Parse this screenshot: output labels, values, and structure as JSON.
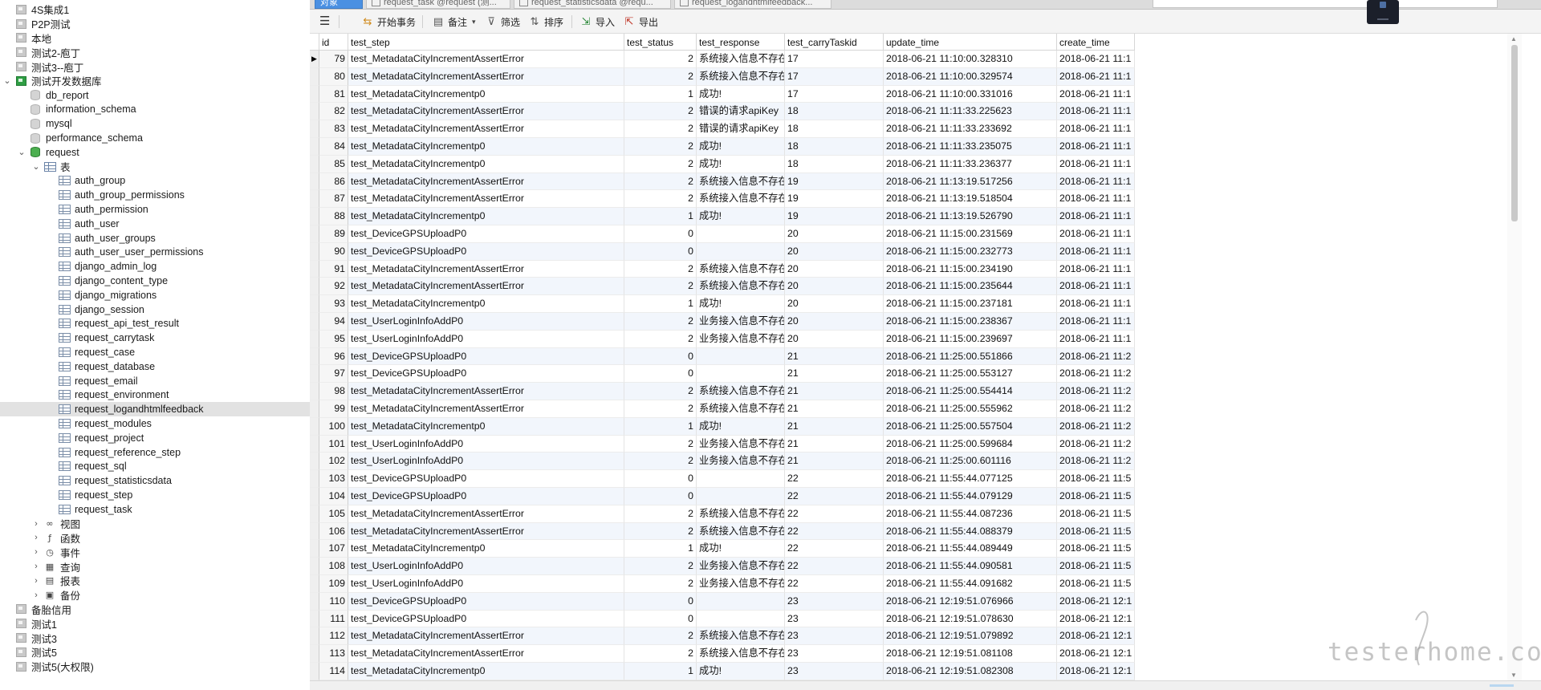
{
  "tabs": [
    {
      "label": "对象",
      "active": true
    },
    {
      "label": "request_task @request (测...",
      "active": false
    },
    {
      "label": "request_statisticsdata @requ...",
      "active": false
    },
    {
      "label": "request_logandhtmlfeedback...",
      "active": false
    }
  ],
  "toolbar": {
    "begin_tx": "开始事务",
    "memo": "备注",
    "filter": "筛选",
    "sort": "排序",
    "import": "导入",
    "export": "导出"
  },
  "tree": [
    {
      "label": "4S集成1",
      "depth": 0,
      "icon": "connection-icon",
      "expander": ""
    },
    {
      "label": "P2P测试",
      "depth": 0,
      "icon": "connection-icon",
      "expander": ""
    },
    {
      "label": "本地",
      "depth": 0,
      "icon": "connection-icon",
      "expander": ""
    },
    {
      "label": "测试2-庖丁",
      "depth": 0,
      "icon": "connection-icon",
      "expander": ""
    },
    {
      "label": "测试3--庖丁",
      "depth": 0,
      "icon": "connection-icon",
      "expander": ""
    },
    {
      "label": "测试开发数据库",
      "depth": 0,
      "icon": "connection-open-icon",
      "expander": "expanded"
    },
    {
      "label": "db_report",
      "depth": 1,
      "icon": "database-icon",
      "expander": ""
    },
    {
      "label": "information_schema",
      "depth": 1,
      "icon": "database-icon",
      "expander": ""
    },
    {
      "label": "mysql",
      "depth": 1,
      "icon": "database-icon",
      "expander": ""
    },
    {
      "label": "performance_schema",
      "depth": 1,
      "icon": "database-icon",
      "expander": ""
    },
    {
      "label": "request",
      "depth": 1,
      "icon": "database-open-icon",
      "expander": "expanded"
    },
    {
      "label": "表",
      "depth": 2,
      "icon": "tables-folder-icon",
      "expander": "expanded"
    },
    {
      "label": "auth_group",
      "depth": 3,
      "icon": "table-icon",
      "expander": ""
    },
    {
      "label": "auth_group_permissions",
      "depth": 3,
      "icon": "table-icon",
      "expander": ""
    },
    {
      "label": "auth_permission",
      "depth": 3,
      "icon": "table-icon",
      "expander": ""
    },
    {
      "label": "auth_user",
      "depth": 3,
      "icon": "table-icon",
      "expander": ""
    },
    {
      "label": "auth_user_groups",
      "depth": 3,
      "icon": "table-icon",
      "expander": ""
    },
    {
      "label": "auth_user_user_permissions",
      "depth": 3,
      "icon": "table-icon",
      "expander": ""
    },
    {
      "label": "django_admin_log",
      "depth": 3,
      "icon": "table-icon",
      "expander": ""
    },
    {
      "label": "django_content_type",
      "depth": 3,
      "icon": "table-icon",
      "expander": ""
    },
    {
      "label": "django_migrations",
      "depth": 3,
      "icon": "table-icon",
      "expander": ""
    },
    {
      "label": "django_session",
      "depth": 3,
      "icon": "table-icon",
      "expander": ""
    },
    {
      "label": "request_api_test_result",
      "depth": 3,
      "icon": "table-icon",
      "expander": ""
    },
    {
      "label": "request_carrytask",
      "depth": 3,
      "icon": "table-icon",
      "expander": ""
    },
    {
      "label": "request_case",
      "depth": 3,
      "icon": "table-icon",
      "expander": ""
    },
    {
      "label": "request_database",
      "depth": 3,
      "icon": "table-icon",
      "expander": ""
    },
    {
      "label": "request_email",
      "depth": 3,
      "icon": "table-icon",
      "expander": ""
    },
    {
      "label": "request_environment",
      "depth": 3,
      "icon": "table-icon",
      "expander": ""
    },
    {
      "label": "request_logandhtmlfeedback",
      "depth": 3,
      "icon": "table-icon",
      "expander": "",
      "selected": true
    },
    {
      "label": "request_modules",
      "depth": 3,
      "icon": "table-icon",
      "expander": ""
    },
    {
      "label": "request_project",
      "depth": 3,
      "icon": "table-icon",
      "expander": ""
    },
    {
      "label": "request_reference_step",
      "depth": 3,
      "icon": "table-icon",
      "expander": ""
    },
    {
      "label": "request_sql",
      "depth": 3,
      "icon": "table-icon",
      "expander": ""
    },
    {
      "label": "request_statisticsdata",
      "depth": 3,
      "icon": "table-icon",
      "expander": ""
    },
    {
      "label": "request_step",
      "depth": 3,
      "icon": "table-icon",
      "expander": ""
    },
    {
      "label": "request_task",
      "depth": 3,
      "icon": "table-icon",
      "expander": ""
    },
    {
      "label": "视图",
      "depth": 2,
      "icon": "views-icon",
      "expander": "collapsed"
    },
    {
      "label": "函数",
      "depth": 2,
      "icon": "functions-icon",
      "expander": "collapsed"
    },
    {
      "label": "事件",
      "depth": 2,
      "icon": "events-icon",
      "expander": "collapsed"
    },
    {
      "label": "查询",
      "depth": 2,
      "icon": "queries-icon",
      "expander": "collapsed"
    },
    {
      "label": "报表",
      "depth": 2,
      "icon": "reports-icon",
      "expander": "collapsed"
    },
    {
      "label": "备份",
      "depth": 2,
      "icon": "backups-icon",
      "expander": "collapsed"
    },
    {
      "label": "备胎信用",
      "depth": 0,
      "icon": "connection-icon",
      "expander": ""
    },
    {
      "label": "测试1",
      "depth": 0,
      "icon": "connection-icon",
      "expander": ""
    },
    {
      "label": "测试3",
      "depth": 0,
      "icon": "connection-icon",
      "expander": ""
    },
    {
      "label": "测试5",
      "depth": 0,
      "icon": "connection-icon",
      "expander": ""
    },
    {
      "label": "测试5(大权限)",
      "depth": 0,
      "icon": "connection-icon",
      "expander": ""
    }
  ],
  "grid": {
    "columns": [
      "id",
      "test_step",
      "test_status",
      "test_response",
      "test_carryTaskid",
      "update_time",
      "create_time"
    ],
    "current_row_marker": "▶",
    "rows": [
      [
        "79",
        "test_MetadataCityIncrementAssertError",
        "2",
        "系统接入信息不存在",
        "17",
        "2018-06-21 11:10:00.328310",
        "2018-06-21 11:1"
      ],
      [
        "80",
        "test_MetadataCityIncrementAssertError",
        "2",
        "系统接入信息不存在",
        "17",
        "2018-06-21 11:10:00.329574",
        "2018-06-21 11:1"
      ],
      [
        "81",
        "test_MetadataCityIncrementp0",
        "1",
        "成功!",
        "17",
        "2018-06-21 11:10:00.331016",
        "2018-06-21 11:1"
      ],
      [
        "82",
        "test_MetadataCityIncrementAssertError",
        "2",
        "错误的请求apiKey",
        "18",
        "2018-06-21 11:11:33.225623",
        "2018-06-21 11:1"
      ],
      [
        "83",
        "test_MetadataCityIncrementAssertError",
        "2",
        "错误的请求apiKey",
        "18",
        "2018-06-21 11:11:33.233692",
        "2018-06-21 11:1"
      ],
      [
        "84",
        "test_MetadataCityIncrementp0",
        "2",
        "成功!",
        "18",
        "2018-06-21 11:11:33.235075",
        "2018-06-21 11:1"
      ],
      [
        "85",
        "test_MetadataCityIncrementp0",
        "2",
        "成功!",
        "18",
        "2018-06-21 11:11:33.236377",
        "2018-06-21 11:1"
      ],
      [
        "86",
        "test_MetadataCityIncrementAssertError",
        "2",
        "系统接入信息不存在",
        "19",
        "2018-06-21 11:13:19.517256",
        "2018-06-21 11:1"
      ],
      [
        "87",
        "test_MetadataCityIncrementAssertError",
        "2",
        "系统接入信息不存在",
        "19",
        "2018-06-21 11:13:19.518504",
        "2018-06-21 11:1"
      ],
      [
        "88",
        "test_MetadataCityIncrementp0",
        "1",
        "成功!",
        "19",
        "2018-06-21 11:13:19.526790",
        "2018-06-21 11:1"
      ],
      [
        "89",
        "test_DeviceGPSUploadP0",
        "0",
        "",
        "20",
        "2018-06-21 11:15:00.231569",
        "2018-06-21 11:1"
      ],
      [
        "90",
        "test_DeviceGPSUploadP0",
        "0",
        "",
        "20",
        "2018-06-21 11:15:00.232773",
        "2018-06-21 11:1"
      ],
      [
        "91",
        "test_MetadataCityIncrementAssertError",
        "2",
        "系统接入信息不存在",
        "20",
        "2018-06-21 11:15:00.234190",
        "2018-06-21 11:1"
      ],
      [
        "92",
        "test_MetadataCityIncrementAssertError",
        "2",
        "系统接入信息不存在",
        "20",
        "2018-06-21 11:15:00.235644",
        "2018-06-21 11:1"
      ],
      [
        "93",
        "test_MetadataCityIncrementp0",
        "1",
        "成功!",
        "20",
        "2018-06-21 11:15:00.237181",
        "2018-06-21 11:1"
      ],
      [
        "94",
        "test_UserLoginInfoAddP0",
        "2",
        "业务接入信息不存在",
        "20",
        "2018-06-21 11:15:00.238367",
        "2018-06-21 11:1"
      ],
      [
        "95",
        "test_UserLoginInfoAddP0",
        "2",
        "业务接入信息不存在",
        "20",
        "2018-06-21 11:15:00.239697",
        "2018-06-21 11:1"
      ],
      [
        "96",
        "test_DeviceGPSUploadP0",
        "0",
        "",
        "21",
        "2018-06-21 11:25:00.551866",
        "2018-06-21 11:2"
      ],
      [
        "97",
        "test_DeviceGPSUploadP0",
        "0",
        "",
        "21",
        "2018-06-21 11:25:00.553127",
        "2018-06-21 11:2"
      ],
      [
        "98",
        "test_MetadataCityIncrementAssertError",
        "2",
        "系统接入信息不存在",
        "21",
        "2018-06-21 11:25:00.554414",
        "2018-06-21 11:2"
      ],
      [
        "99",
        "test_MetadataCityIncrementAssertError",
        "2",
        "系统接入信息不存在",
        "21",
        "2018-06-21 11:25:00.555962",
        "2018-06-21 11:2"
      ],
      [
        "100",
        "test_MetadataCityIncrementp0",
        "1",
        "成功!",
        "21",
        "2018-06-21 11:25:00.557504",
        "2018-06-21 11:2"
      ],
      [
        "101",
        "test_UserLoginInfoAddP0",
        "2",
        "业务接入信息不存在",
        "21",
        "2018-06-21 11:25:00.599684",
        "2018-06-21 11:2"
      ],
      [
        "102",
        "test_UserLoginInfoAddP0",
        "2",
        "业务接入信息不存在",
        "21",
        "2018-06-21 11:25:00.601116",
        "2018-06-21 11:2"
      ],
      [
        "103",
        "test_DeviceGPSUploadP0",
        "0",
        "",
        "22",
        "2018-06-21 11:55:44.077125",
        "2018-06-21 11:5"
      ],
      [
        "104",
        "test_DeviceGPSUploadP0",
        "0",
        "",
        "22",
        "2018-06-21 11:55:44.079129",
        "2018-06-21 11:5"
      ],
      [
        "105",
        "test_MetadataCityIncrementAssertError",
        "2",
        "系统接入信息不存在",
        "22",
        "2018-06-21 11:55:44.087236",
        "2018-06-21 11:5"
      ],
      [
        "106",
        "test_MetadataCityIncrementAssertError",
        "2",
        "系统接入信息不存在",
        "22",
        "2018-06-21 11:55:44.088379",
        "2018-06-21 11:5"
      ],
      [
        "107",
        "test_MetadataCityIncrementp0",
        "1",
        "成功!",
        "22",
        "2018-06-21 11:55:44.089449",
        "2018-06-21 11:5"
      ],
      [
        "108",
        "test_UserLoginInfoAddP0",
        "2",
        "业务接入信息不存在",
        "22",
        "2018-06-21 11:55:44.090581",
        "2018-06-21 11:5"
      ],
      [
        "109",
        "test_UserLoginInfoAddP0",
        "2",
        "业务接入信息不存在",
        "22",
        "2018-06-21 11:55:44.091682",
        "2018-06-21 11:5"
      ],
      [
        "110",
        "test_DeviceGPSUploadP0",
        "0",
        "",
        "23",
        "2018-06-21 12:19:51.076966",
        "2018-06-21 12:1"
      ],
      [
        "111",
        "test_DeviceGPSUploadP0",
        "0",
        "",
        "23",
        "2018-06-21 12:19:51.078630",
        "2018-06-21 12:1"
      ],
      [
        "112",
        "test_MetadataCityIncrementAssertError",
        "2",
        "系统接入信息不存在",
        "23",
        "2018-06-21 12:19:51.079892",
        "2018-06-21 12:1"
      ],
      [
        "113",
        "test_MetadataCityIncrementAssertError",
        "2",
        "系统接入信息不存在",
        "23",
        "2018-06-21 12:19:51.081108",
        "2018-06-21 12:1"
      ],
      [
        "114",
        "test_MetadataCityIncrementp0",
        "1",
        "成功!",
        "23",
        "2018-06-21 12:19:51.082308",
        "2018-06-21 12:1"
      ]
    ]
  },
  "watermark": "testerhome.com",
  "colors": {
    "active_tab": "#4a90e2",
    "selected_tree_row": "#e2e2e2",
    "alt_row": "#f2f6fc",
    "open_connection": "#2f9e44"
  }
}
